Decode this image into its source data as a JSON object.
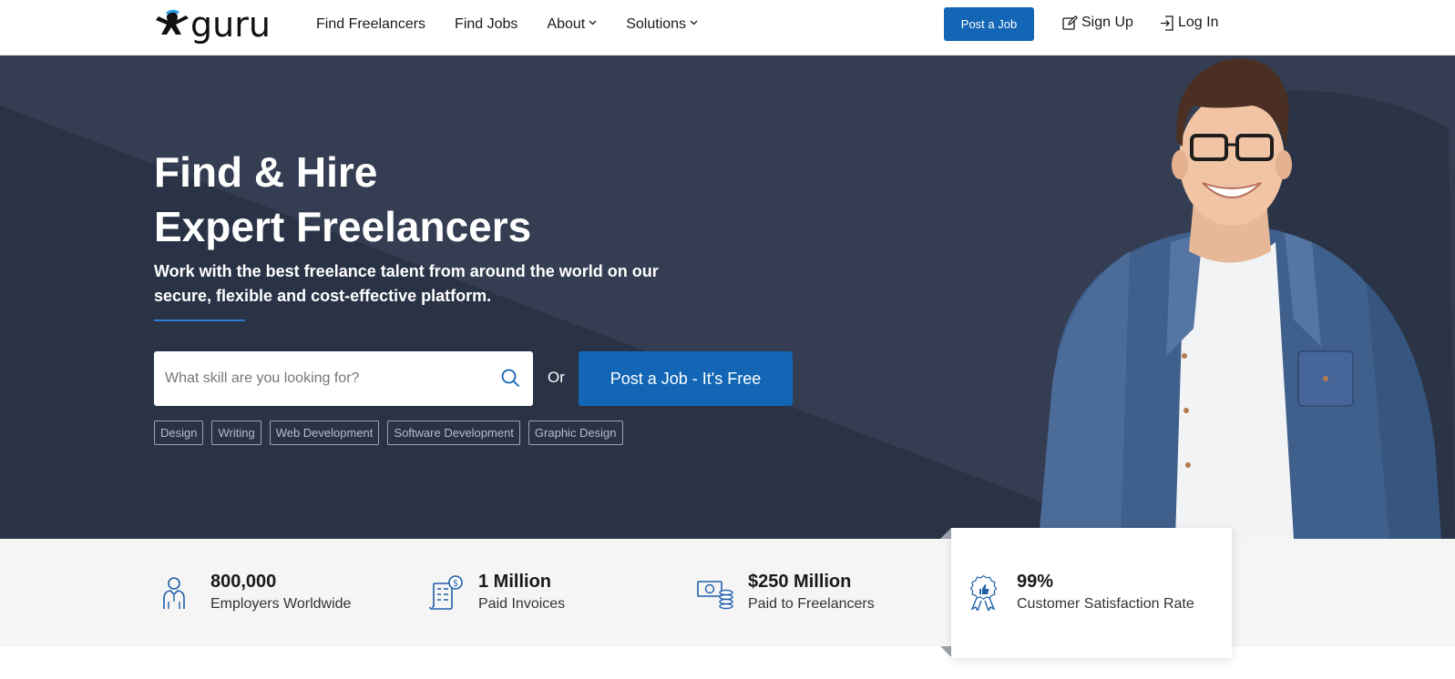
{
  "header": {
    "logo_text": "guru",
    "nav": [
      {
        "label": "Find Freelancers",
        "has_dropdown": false
      },
      {
        "label": "Find Jobs",
        "has_dropdown": false
      },
      {
        "label": "About",
        "has_dropdown": true
      },
      {
        "label": "Solutions",
        "has_dropdown": true
      }
    ],
    "post_job_label": "Post a Job",
    "signup_label": "Sign Up",
    "login_label": "Log In"
  },
  "hero": {
    "title_line1": "Find & Hire",
    "title_line2": "Expert Freelancers",
    "subtitle": "Work with the best freelance talent from around the world on our secure, flexible and cost-effective platform.",
    "search_placeholder": "What skill are you looking for?",
    "search_value": "",
    "or_text": "Or",
    "post_job_label": "Post a Job - It's Free",
    "tags": [
      "Design",
      "Writing",
      "Web Development",
      "Software Development",
      "Graphic Design"
    ]
  },
  "stats": [
    {
      "value": "800,000",
      "label": "Employers Worldwide",
      "icon": "employer-icon"
    },
    {
      "value": "1 Million",
      "label": "Paid Invoices",
      "icon": "invoice-icon"
    },
    {
      "value": "$250 Million",
      "label": "Paid to Freelancers",
      "icon": "money-icon"
    },
    {
      "value": "99%",
      "label": "Customer Satisfaction Rate",
      "icon": "award-icon"
    }
  ],
  "colors": {
    "brand_blue": "#1266b5",
    "hero_dark": "#2a3346",
    "hero_light": "#343d51",
    "icon_blue": "#1f5fa8",
    "stats_bg": "#f5f5f5"
  }
}
